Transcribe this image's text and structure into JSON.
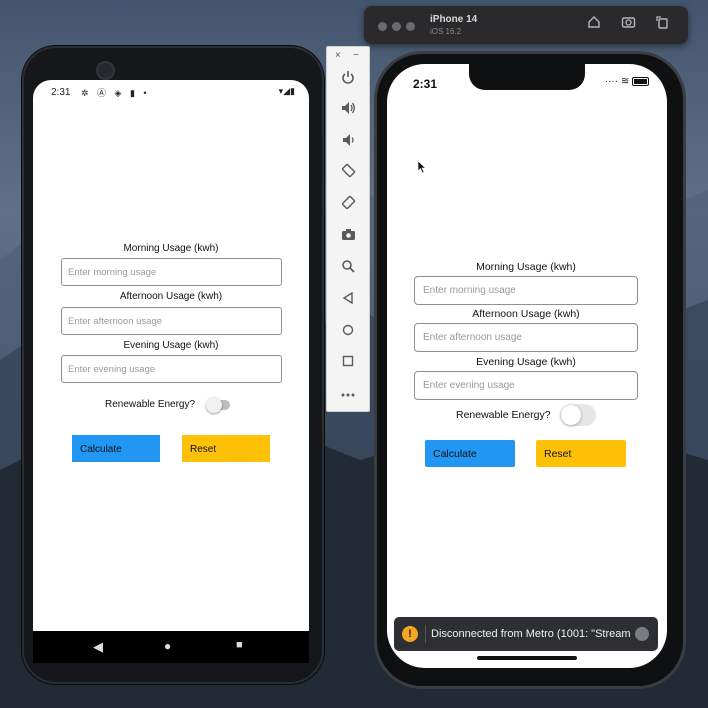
{
  "ios_titlebar": {
    "device": "iPhone 14",
    "os": "iOS 16.2",
    "icons": [
      "home-icon",
      "screenshot-icon",
      "rotate-icon"
    ]
  },
  "android": {
    "status_time": "2:31",
    "status_icons": "✲ Ⓐ ◈ ▮ •",
    "status_right": "▾◢▮",
    "form": {
      "morning_label": "Morning Usage (kwh)",
      "morning_placeholder": "Enter morning usage",
      "afternoon_label": "Afternoon Usage (kwh)",
      "afternoon_placeholder": "Enter afternoon usage",
      "evening_label": "Evening Usage (kwh)",
      "evening_placeholder": "Enter evening usage",
      "renewable_label": "Renewable Energy?",
      "calculate_label": "Calculate",
      "reset_label": "Reset"
    },
    "nav": {
      "back": "◀",
      "home": "●",
      "recents": "■"
    }
  },
  "emulator_toolbar": {
    "close": "×",
    "minimize": "−",
    "buttons": [
      {
        "name": "power-icon",
        "glyph": "⏻"
      },
      {
        "name": "volume-up-icon",
        "glyph": "🔊"
      },
      {
        "name": "volume-down-icon",
        "glyph": "🔈"
      },
      {
        "name": "rotate-left-icon",
        "glyph": "⟲"
      },
      {
        "name": "rotate-right-icon",
        "glyph": "⟳"
      },
      {
        "name": "camera-icon",
        "glyph": "📷"
      },
      {
        "name": "zoom-icon",
        "glyph": "🔍"
      },
      {
        "name": "back-icon",
        "glyph": "◁"
      },
      {
        "name": "home-icon",
        "glyph": "○"
      },
      {
        "name": "overview-icon",
        "glyph": "□"
      },
      {
        "name": "more-icon",
        "glyph": "•••"
      }
    ]
  },
  "ios": {
    "status_time": "2:31",
    "status_right": "···· ≋",
    "form": {
      "morning_label": "Morning Usage (kwh)",
      "morning_placeholder": "Enter morning usage",
      "afternoon_label": "Afternoon Usage (kwh)",
      "afternoon_placeholder": "Enter afternoon usage",
      "evening_label": "Evening Usage (kwh)",
      "evening_placeholder": "Enter evening usage",
      "renewable_label": "Renewable Energy?",
      "calculate_label": "Calculate",
      "reset_label": "Reset"
    },
    "toast": {
      "icon": "!",
      "text": "Disconnected from Metro (1001: \"Stream..."
    }
  },
  "colors": {
    "calculate": "#2196f3",
    "reset": "#ffc107"
  }
}
